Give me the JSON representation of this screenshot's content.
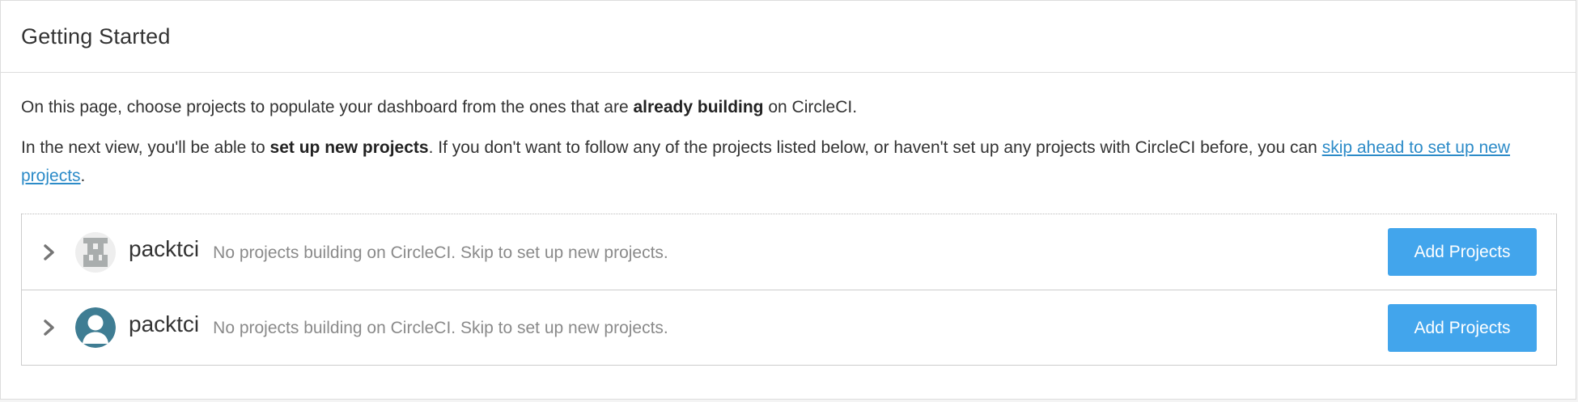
{
  "panel": {
    "title": "Getting Started"
  },
  "intro": {
    "line1": {
      "before": "On this page, choose projects to populate your dashboard from the ones that are ",
      "bold": "already building",
      "after": " on CircleCI."
    },
    "line2": {
      "before": "In the next view, you'll be able to ",
      "bold": "set up new projects",
      "middle": ". If you don't want to follow any of the projects listed below, or haven't set up any projects with CircleCI before, you can ",
      "link": "skip ahead to set up new projects",
      "after": "."
    }
  },
  "orgs": [
    {
      "name": "packtci",
      "status": "No projects building on CircleCI. Skip to set up new projects.",
      "button_label": "Add Projects",
      "avatar": "identicon-avatar"
    },
    {
      "name": "packtci",
      "status": "No projects building on CircleCI. Skip to set up new projects.",
      "button_label": "Add Projects",
      "avatar": "user-silhouette-avatar"
    }
  ],
  "colors": {
    "link": "#2c8bc8",
    "button": "#42a5ec",
    "avatar_teal": "#3f7d93",
    "identicon_gray": "#a9adad"
  },
  "icons": {
    "expand": "chevron-right-icon"
  }
}
